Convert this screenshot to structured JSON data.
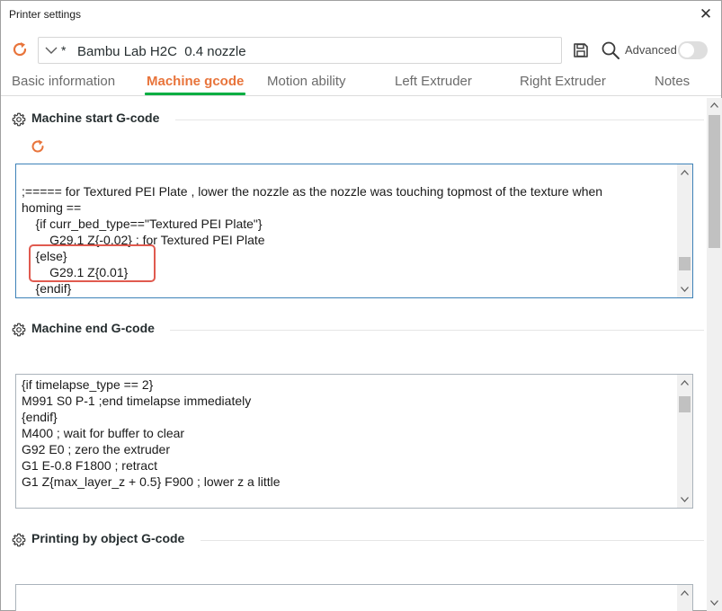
{
  "window": {
    "title": "Printer settings",
    "close_icon": "close-icon"
  },
  "toolbar": {
    "preset_modified_marker": "*",
    "preset_name": "Bambu Lab H2C  0.4 nozzle",
    "advanced_label": "Advanced",
    "advanced_enabled": false,
    "accent_color": "#e8743b"
  },
  "tabs": [
    {
      "label": "Basic information",
      "active": false
    },
    {
      "label": "Machine gcode",
      "active": true
    },
    {
      "label": "Motion ability",
      "active": false
    },
    {
      "label": "Left Extruder",
      "active": false
    },
    {
      "label": "Right Extruder",
      "active": false
    },
    {
      "label": "Notes",
      "active": false
    }
  ],
  "sections": {
    "start": {
      "title": "Machine start G-code",
      "lines": [
        ";===== for Textured PEI Plate , lower the nozzle as the nozzle was touching topmost of the texture when",
        "homing ==",
        "    {if curr_bed_type==\"Textured PEI Plate\"}",
        "        G29.1 Z{-0.02} ; for Textured PEI Plate",
        "    {else}",
        "        G29.1 Z{0.01}",
        "    {endif}"
      ]
    },
    "end": {
      "title": "Machine end G-code",
      "lines": [
        "{if timelapse_type == 2}",
        "M991 S0 P-1 ;end timelapse immediately",
        "{endif}",
        "M400 ; wait for buffer to clear",
        "G92 E0 ; zero the extruder",
        "G1 E-0.8 F1800 ; retract",
        "G1 Z{max_layer_z + 0.5} F900 ; lower z a little"
      ]
    },
    "by_object": {
      "title": "Printing by object G-code",
      "lines": []
    }
  }
}
